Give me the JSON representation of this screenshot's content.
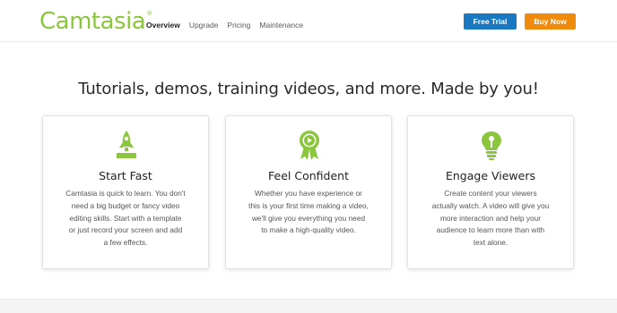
{
  "header": {
    "logo_text": "Camtasia",
    "logo_mark": "®",
    "nav": [
      {
        "label": "Overview",
        "active": true
      },
      {
        "label": "Upgrade",
        "active": false
      },
      {
        "label": "Pricing",
        "active": false
      },
      {
        "label": "Maintenance",
        "active": false
      }
    ],
    "free_trial_label": "Free Trial",
    "buy_now_label": "Buy Now"
  },
  "colors": {
    "brand_green": "#8cc63e",
    "trial_blue": "#1a78c2",
    "buy_orange": "#f08a0c"
  },
  "main": {
    "headline": "Tutorials, demos, training videos, and more. Made by you!"
  },
  "cards": [
    {
      "icon": "rocket-icon",
      "title": "Start Fast",
      "lines": [
        "Camtasia is quick to learn. You don't",
        "need a big budget or fancy video",
        "editing skills. Start with a template",
        "or just record your screen and add",
        "a few effects."
      ]
    },
    {
      "icon": "award-ribbon-icon",
      "title": "Feel Confident",
      "lines": [
        "Whether you have experience or",
        "this is your first time making a video,",
        "we'll give you everything you need",
        "to make a high-quality video."
      ]
    },
    {
      "icon": "lightbulb-icon",
      "title": "Engage Viewers",
      "lines": [
        "Create content your viewers",
        "actually watch. A video will give you",
        "more interaction and help your",
        "audience to learn more than with",
        "text alone."
      ]
    }
  ]
}
